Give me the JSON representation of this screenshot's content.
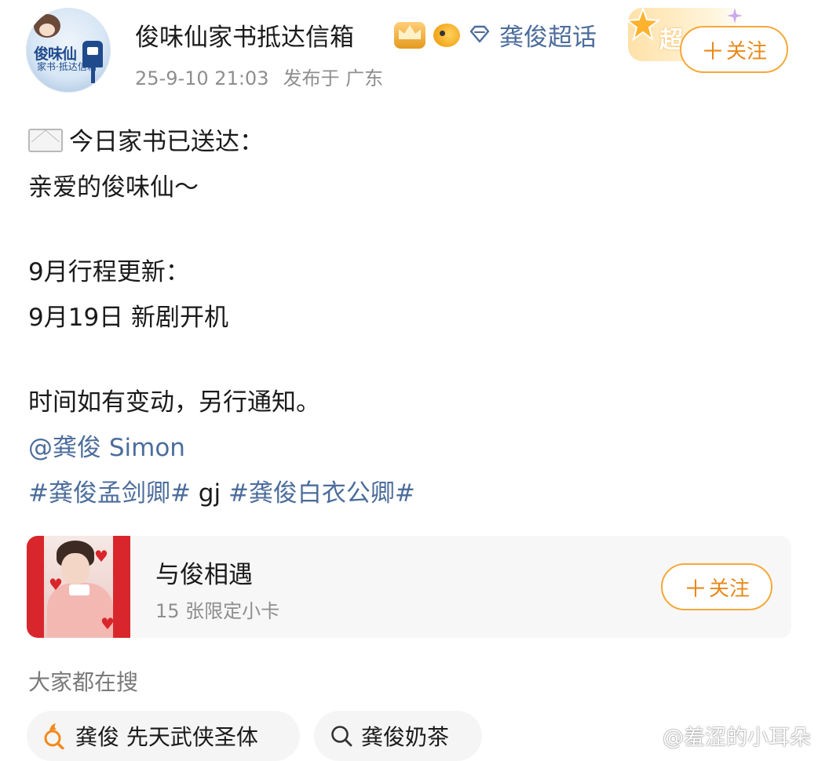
{
  "header": {
    "account_name": "俊味仙家书抵达信箱",
    "avatar_text_line1": "俊味仙",
    "avatar_text_line2": "家书·抵达信箱",
    "supertopic_label": "龚俊超话",
    "super_badge_text": "超",
    "timestamp": "25-9-10 21:03",
    "location": "发布于 广东",
    "follow_label": "关注"
  },
  "post": {
    "line1": "今日家书已送达：",
    "line2": "亲爱的俊味仙～",
    "line3": "9月行程更新：",
    "line4": "9月19日 新剧开机",
    "line5": "时间如有变动，另行通知。",
    "mention": "@龚俊 Simon",
    "hashtag1": "#龚俊孟剑卿#",
    "middle_text": " gj ",
    "hashtag2": "#龚俊白衣公卿#"
  },
  "card": {
    "title": "与俊相遇",
    "subtitle": "15 张限定小卡",
    "follow_label": "关注"
  },
  "search": {
    "title": "大家都在搜",
    "chips": [
      "龚俊 先天武侠圣体",
      "龚俊奶茶"
    ]
  },
  "watermark": "@羞涩的小耳朵",
  "colors": {
    "link": "#4c6d9c",
    "accent_orange": "#f5a83a",
    "meta_gray": "#8e8e8e"
  }
}
